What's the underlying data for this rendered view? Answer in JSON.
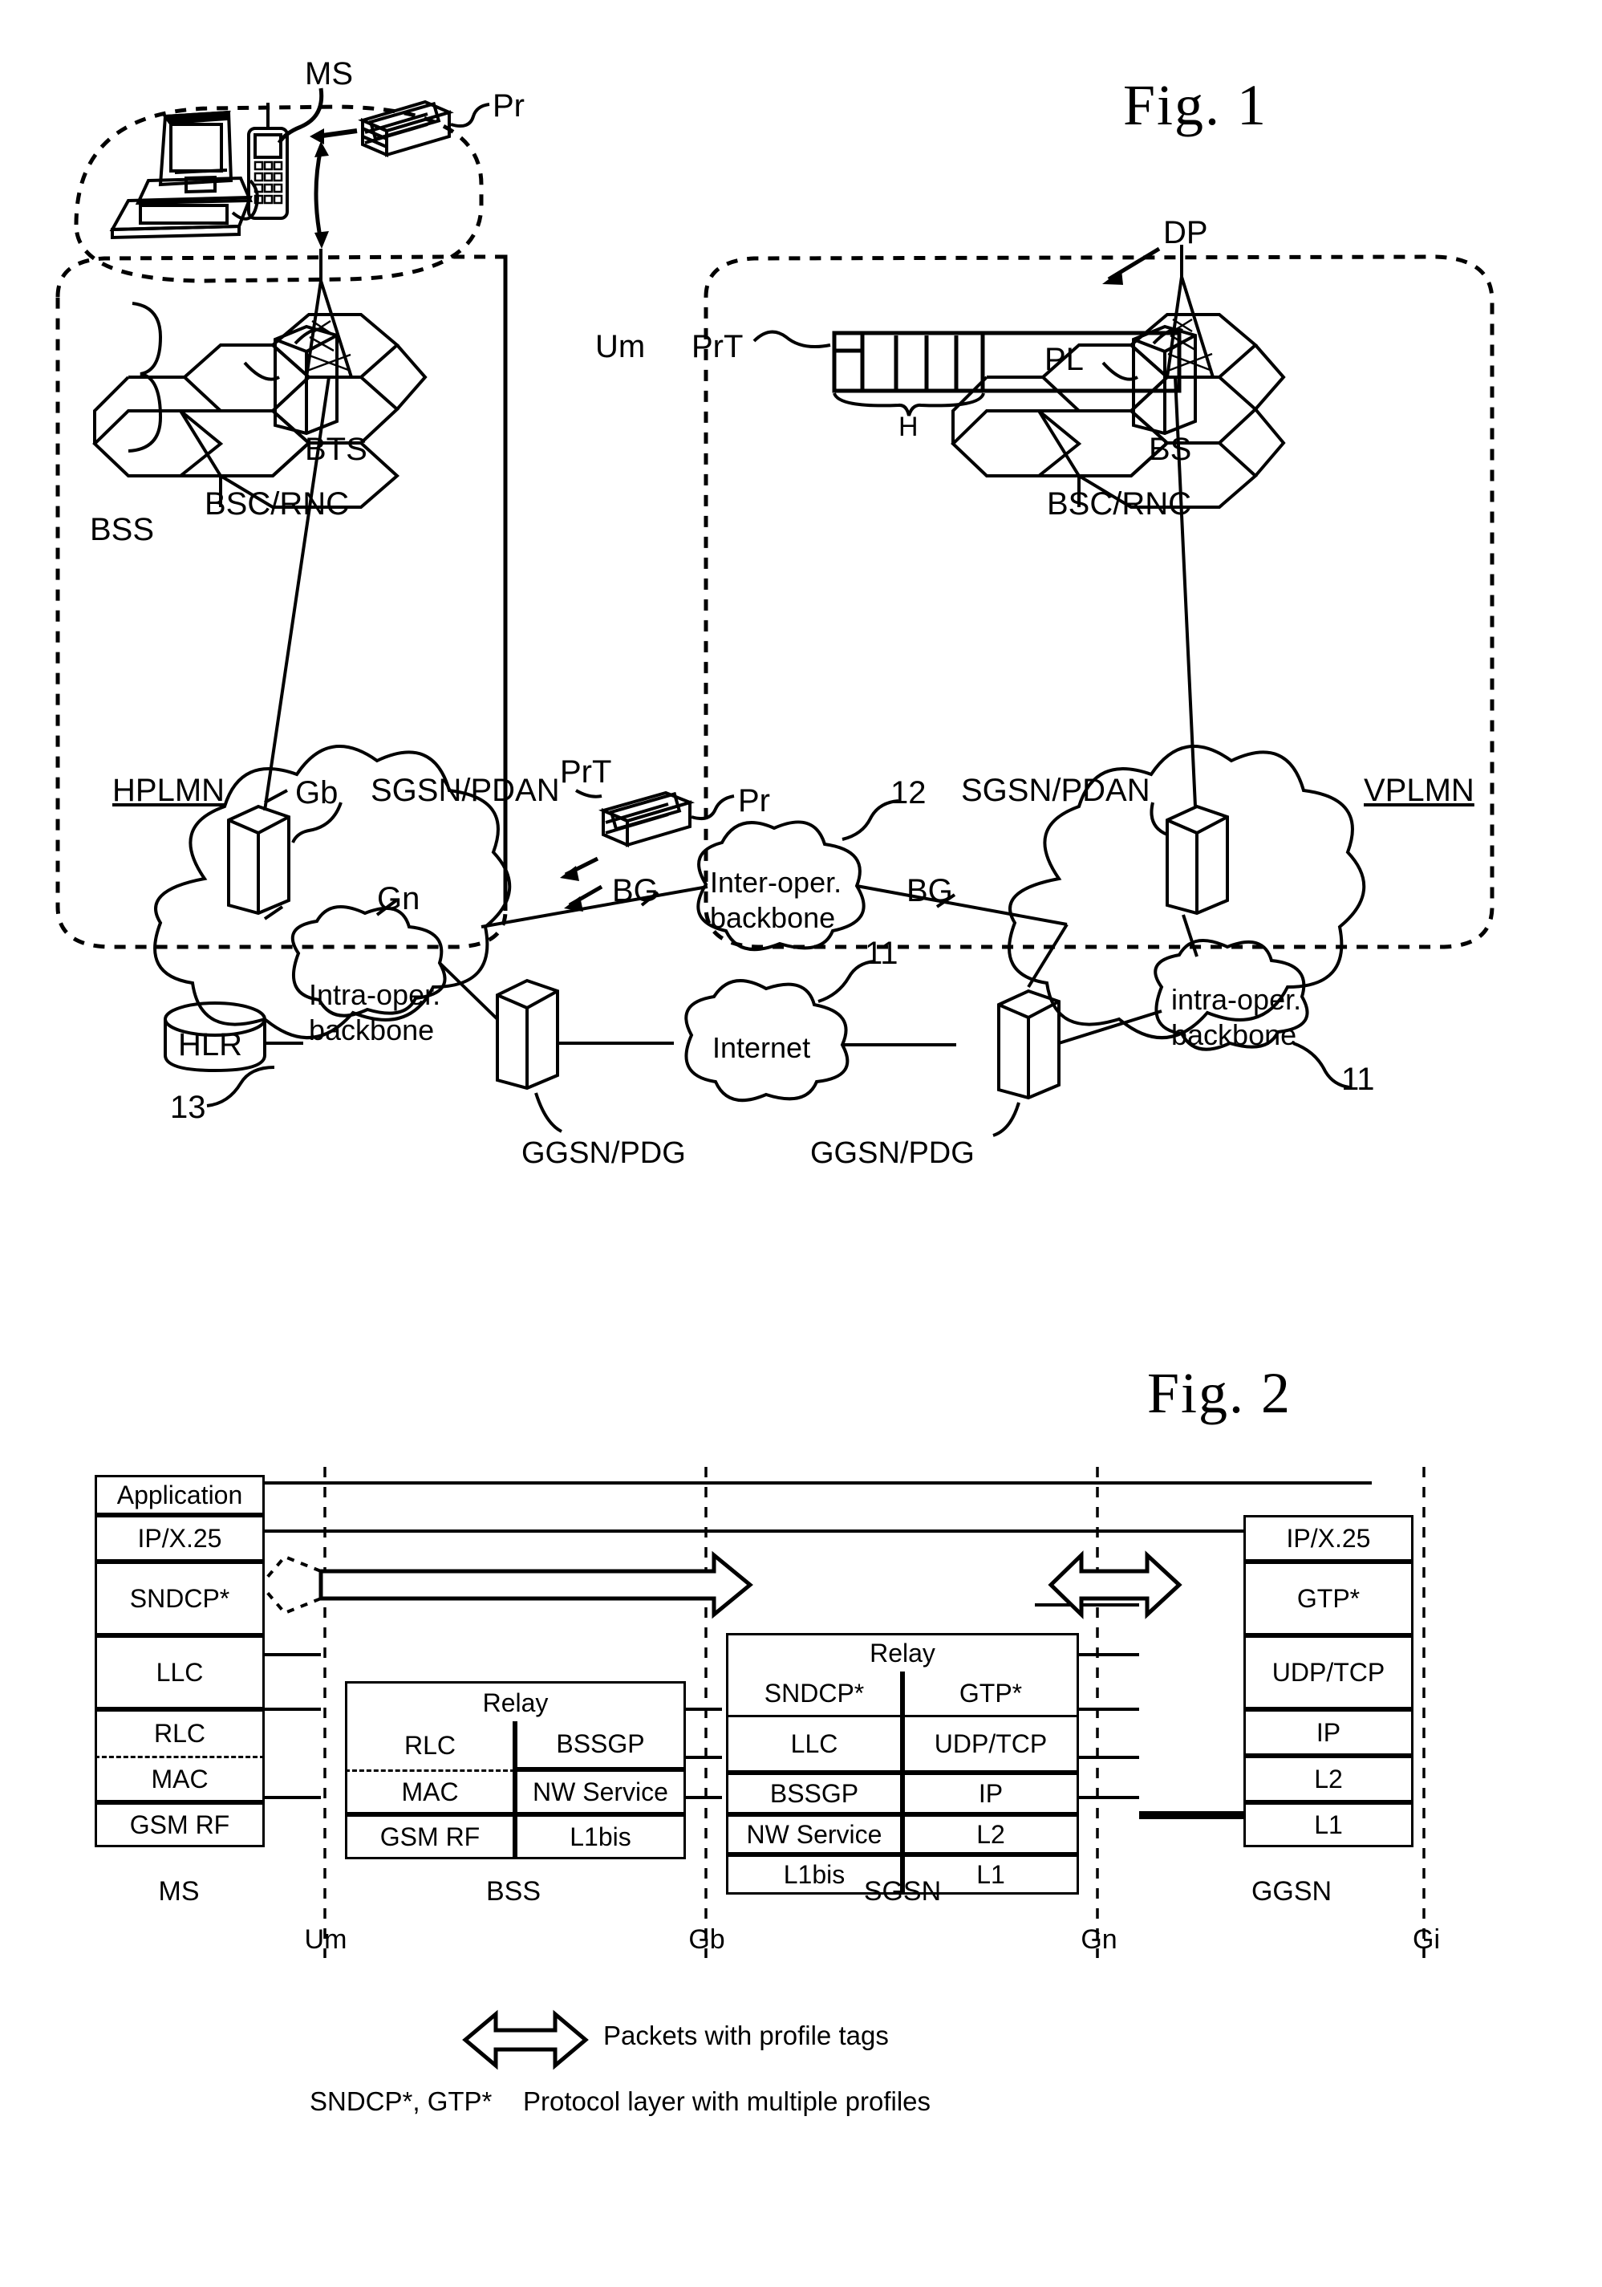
{
  "figures": {
    "fig1": {
      "title": "Fig. 1",
      "ms_label": "MS",
      "packets_pr_top": "Pr",
      "um_label": "Um",
      "prt_label_top": "PrT",
      "dp_label": "DP",
      "pl_label": "PL",
      "h_label": "H",
      "bts_label": "BTS",
      "bsc_rnc_left": "BSC/RNC",
      "bss_label": "BSS",
      "hplmn_label": "HPLMN",
      "gb_label": "Gb",
      "sgsn_pdan_left": "SGSN/PDAN",
      "gn_label": "Gn",
      "hlr_label": "HLR",
      "intra_oper_backbone_left": "Intra-oper.\nbackbone",
      "intra_line1": "Intra-oper.",
      "intra_line2": "backbone",
      "inter_line1": "Inter-oper.",
      "inter_line2": "backbone",
      "internet_label": "Internet",
      "bg_left": "BG",
      "bg_right": "BG",
      "ref_12": "12",
      "ref_11_left": "11",
      "ref_11_right": "11",
      "ref_13": "13",
      "ggsn_pdg_left": "GGSN/PDG",
      "ggsn_pdg_right": "GGSN/PDG",
      "prt_label_mid": "PrT",
      "packets_pr_mid": "Pr",
      "bs_label": "BS",
      "bsc_rnc_right": "BSC/RNC",
      "sgsn_pdan_right": "SGSN/PDAN",
      "vplmn_label": "VPLMN",
      "intra_right_line1": "intra-oper.",
      "intra_right_line2": "backbone"
    },
    "fig2": {
      "title": "Fig. 2",
      "columns": [
        {
          "name": "MS",
          "layers": [
            "Application",
            "IP/X.25",
            "SNDCP*",
            "LLC",
            "RLC",
            "MAC",
            "GSM RF"
          ]
        },
        {
          "name": "BSS",
          "relay_label": "Relay",
          "left_layers": [
            "RLC",
            "MAC",
            "GSM RF"
          ],
          "right_layers": [
            "BSSGP",
            "NW Service",
            "L1bis"
          ]
        },
        {
          "name": "SGSN",
          "relay_label": "Relay",
          "left_layers": [
            "SNDCP*",
            "LLC",
            "BSSGP",
            "NW Service",
            "L1bis"
          ],
          "right_layers": [
            "GTP*",
            "UDP/TCP",
            "IP",
            "L2",
            "L1"
          ]
        },
        {
          "name": "GGSN",
          "layers": [
            "IP/X.25",
            "GTP*",
            "UDP/TCP",
            "IP",
            "L2",
            "L1"
          ]
        }
      ],
      "interfaces": [
        "Um",
        "Gb",
        "Gn",
        "Gi"
      ],
      "legend": {
        "arrow_text": "Packets with profile tags",
        "star_prefix": "SNDCP*, GTP*",
        "star_text": "Protocol layer with multiple profiles"
      }
    }
  },
  "colors": {
    "ink": "#000000",
    "paper": "#ffffff"
  }
}
